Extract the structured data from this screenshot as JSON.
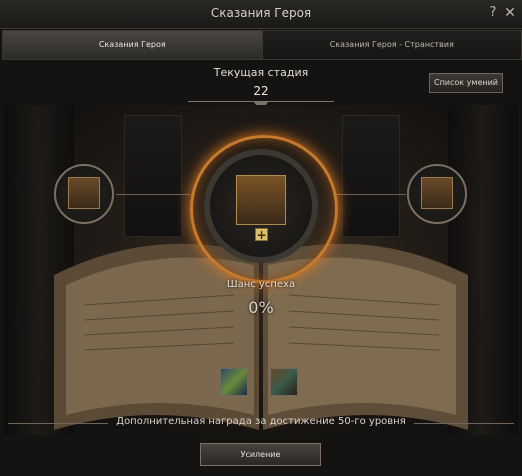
{
  "window": {
    "title": "Сказания Героя",
    "help": "?",
    "close": "✕"
  },
  "tabs": [
    {
      "label": "Сказания Героя",
      "active": true
    },
    {
      "label": "Сказания Героя - Странствия",
      "active": false
    }
  ],
  "stage": {
    "label": "Текущая стадия",
    "value": "22"
  },
  "skills_button": "Список умений",
  "center": {
    "plus": "+"
  },
  "chance": {
    "label": "Шанс успеха",
    "value": "0%"
  },
  "reward_text": "Дополнительная награда за достижение 50-го уровня",
  "upgrade_button": "Усиление",
  "colors": {
    "ring": "#c57a2c",
    "accent": "#d8c06a"
  },
  "icons": {
    "book": "open-book-icon"
  }
}
